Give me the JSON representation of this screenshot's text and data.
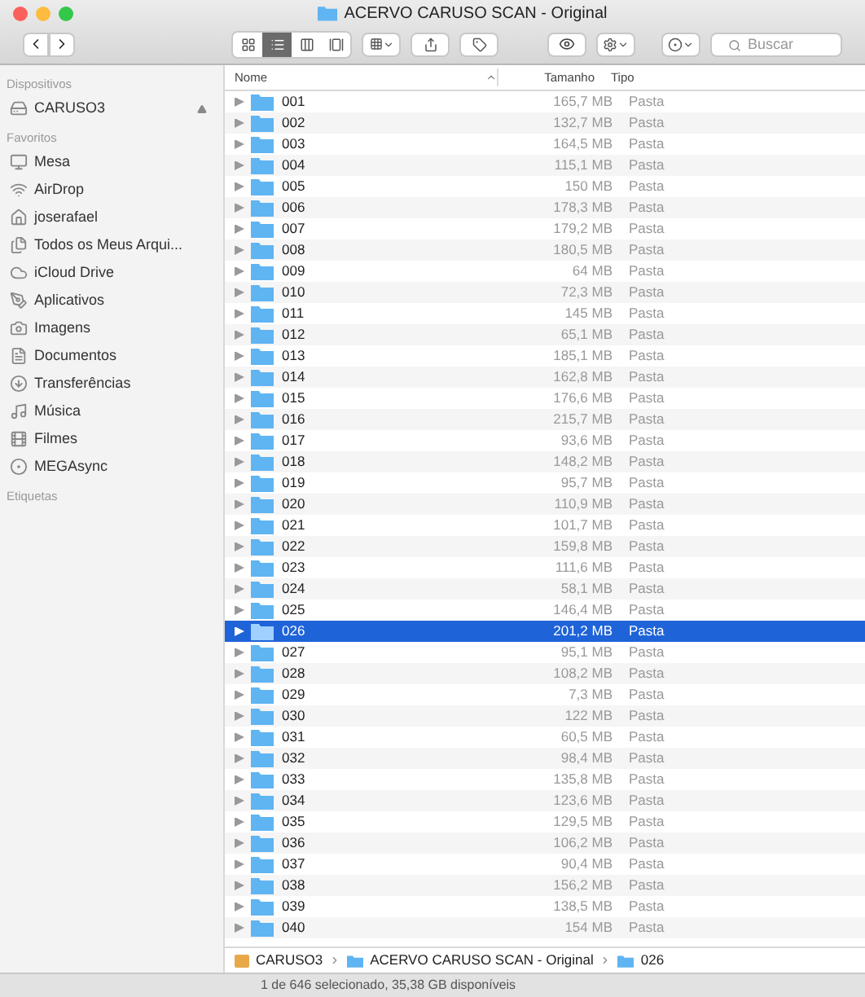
{
  "window": {
    "title": "ACERVO CARUSO SCAN - Original"
  },
  "toolbar": {
    "view_buttons": [
      {
        "kind": "icons",
        "selected": false
      },
      {
        "kind": "list",
        "selected": true
      },
      {
        "kind": "columns",
        "selected": false
      },
      {
        "kind": "cover",
        "selected": false
      }
    ],
    "search": {
      "placeholder": "Buscar"
    }
  },
  "sidebar": {
    "sections": [
      {
        "title": "Dispositivos",
        "items": [
          {
            "label": "CARUSO3",
            "kind": "disk",
            "eject": true
          }
        ]
      },
      {
        "title": "Favoritos",
        "items": [
          {
            "label": "Mesa",
            "kind": "desktop",
            "eject": false
          },
          {
            "label": "AirDrop",
            "kind": "airdrop",
            "eject": false
          },
          {
            "label": "joserafael",
            "kind": "home",
            "eject": false
          },
          {
            "label": "Todos os Meus Arqui...",
            "kind": "files",
            "eject": false
          },
          {
            "label": "iCloud Drive",
            "kind": "cloud",
            "eject": false
          },
          {
            "label": "Aplicativos",
            "kind": "apps",
            "eject": false
          },
          {
            "label": "Imagens",
            "kind": "camera",
            "eject": false
          },
          {
            "label": "Documentos",
            "kind": "document",
            "eject": false
          },
          {
            "label": "Transferências",
            "kind": "download",
            "eject": false
          },
          {
            "label": "Música",
            "kind": "music",
            "eject": false
          },
          {
            "label": "Filmes",
            "kind": "film",
            "eject": false
          },
          {
            "label": "MEGAsync",
            "kind": "mega",
            "eject": false
          }
        ]
      },
      {
        "title": "Etiquetas"
      }
    ]
  },
  "table": {
    "columns": [
      "Nome",
      "Tamanho",
      "Tipo"
    ],
    "rows": [
      {
        "name": "001",
        "size": "165,7 MB",
        "type": "Pasta",
        "selected": false
      },
      {
        "name": "002",
        "size": "132,7 MB",
        "type": "Pasta",
        "selected": false
      },
      {
        "name": "003",
        "size": "164,5 MB",
        "type": "Pasta",
        "selected": false
      },
      {
        "name": "004",
        "size": "115,1 MB",
        "type": "Pasta",
        "selected": false
      },
      {
        "name": "005",
        "size": "150 MB",
        "type": "Pasta",
        "selected": false
      },
      {
        "name": "006",
        "size": "178,3 MB",
        "type": "Pasta",
        "selected": false
      },
      {
        "name": "007",
        "size": "179,2 MB",
        "type": "Pasta",
        "selected": false
      },
      {
        "name": "008",
        "size": "180,5 MB",
        "type": "Pasta",
        "selected": false
      },
      {
        "name": "009",
        "size": "64 MB",
        "type": "Pasta",
        "selected": false
      },
      {
        "name": "010",
        "size": "72,3 MB",
        "type": "Pasta",
        "selected": false
      },
      {
        "name": "011",
        "size": "145 MB",
        "type": "Pasta",
        "selected": false
      },
      {
        "name": "012",
        "size": "65,1 MB",
        "type": "Pasta",
        "selected": false
      },
      {
        "name": "013",
        "size": "185,1 MB",
        "type": "Pasta",
        "selected": false
      },
      {
        "name": "014",
        "size": "162,8 MB",
        "type": "Pasta",
        "selected": false
      },
      {
        "name": "015",
        "size": "176,6 MB",
        "type": "Pasta",
        "selected": false
      },
      {
        "name": "016",
        "size": "215,7 MB",
        "type": "Pasta",
        "selected": false
      },
      {
        "name": "017",
        "size": "93,6 MB",
        "type": "Pasta",
        "selected": false
      },
      {
        "name": "018",
        "size": "148,2 MB",
        "type": "Pasta",
        "selected": false
      },
      {
        "name": "019",
        "size": "95,7 MB",
        "type": "Pasta",
        "selected": false
      },
      {
        "name": "020",
        "size": "110,9 MB",
        "type": "Pasta",
        "selected": false
      },
      {
        "name": "021",
        "size": "101,7 MB",
        "type": "Pasta",
        "selected": false
      },
      {
        "name": "022",
        "size": "159,8 MB",
        "type": "Pasta",
        "selected": false
      },
      {
        "name": "023",
        "size": "111,6 MB",
        "type": "Pasta",
        "selected": false
      },
      {
        "name": "024",
        "size": "58,1 MB",
        "type": "Pasta",
        "selected": false
      },
      {
        "name": "025",
        "size": "146,4 MB",
        "type": "Pasta",
        "selected": false
      },
      {
        "name": "026",
        "size": "201,2 MB",
        "type": "Pasta",
        "selected": true
      },
      {
        "name": "027",
        "size": "95,1 MB",
        "type": "Pasta",
        "selected": false
      },
      {
        "name": "028",
        "size": "108,2 MB",
        "type": "Pasta",
        "selected": false
      },
      {
        "name": "029",
        "size": "7,3 MB",
        "type": "Pasta",
        "selected": false
      },
      {
        "name": "030",
        "size": "122 MB",
        "type": "Pasta",
        "selected": false
      },
      {
        "name": "031",
        "size": "60,5 MB",
        "type": "Pasta",
        "selected": false
      },
      {
        "name": "032",
        "size": "98,4 MB",
        "type": "Pasta",
        "selected": false
      },
      {
        "name": "033",
        "size": "135,8 MB",
        "type": "Pasta",
        "selected": false
      },
      {
        "name": "034",
        "size": "123,6 MB",
        "type": "Pasta",
        "selected": false
      },
      {
        "name": "035",
        "size": "129,5 MB",
        "type": "Pasta",
        "selected": false
      },
      {
        "name": "036",
        "size": "106,2 MB",
        "type": "Pasta",
        "selected": false
      },
      {
        "name": "037",
        "size": "90,4 MB",
        "type": "Pasta",
        "selected": false
      },
      {
        "name": "038",
        "size": "156,2 MB",
        "type": "Pasta",
        "selected": false
      },
      {
        "name": "039",
        "size": "138,5 MB",
        "type": "Pasta",
        "selected": false
      },
      {
        "name": "040",
        "size": "154 MB",
        "type": "Pasta",
        "selected": false
      }
    ]
  },
  "path_bar": [
    {
      "label": "CARUSO3",
      "kind": "disk"
    },
    {
      "label": "ACERVO CARUSO SCAN - Original",
      "kind": "folder"
    },
    {
      "label": "026",
      "kind": "folder"
    }
  ],
  "status_bar": "1 de 646 selecionado, 35,38 GB disponíveis"
}
